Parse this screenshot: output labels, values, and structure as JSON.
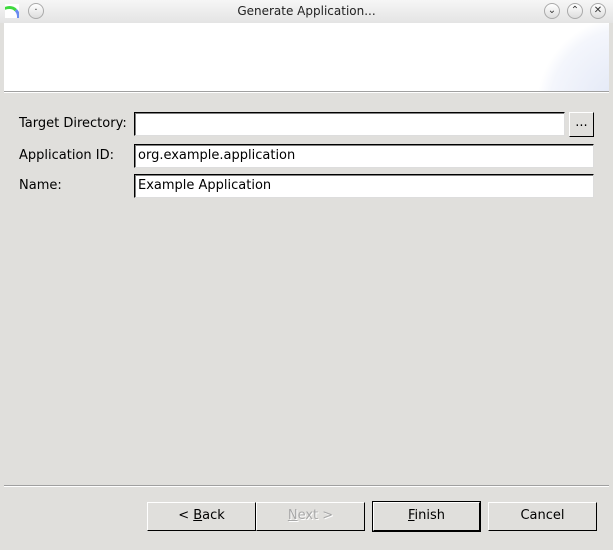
{
  "window": {
    "title": "Generate Application..."
  },
  "form": {
    "target_directory": {
      "label": "Target Directory:",
      "value": "",
      "browse_label": "..."
    },
    "application_id": {
      "label": "Application ID:",
      "value": "org.example.application"
    },
    "name": {
      "label": "Name:",
      "value": "Example Application"
    }
  },
  "buttons": {
    "back": {
      "prefix": "< ",
      "mnemonic": "B",
      "suffix": "ack"
    },
    "next": {
      "prefix": "",
      "mnemonic": "N",
      "suffix": "ext >",
      "enabled": false
    },
    "finish": {
      "prefix": "",
      "mnemonic": "F",
      "suffix": "inish",
      "default": true
    },
    "cancel": {
      "label": "Cancel"
    }
  }
}
